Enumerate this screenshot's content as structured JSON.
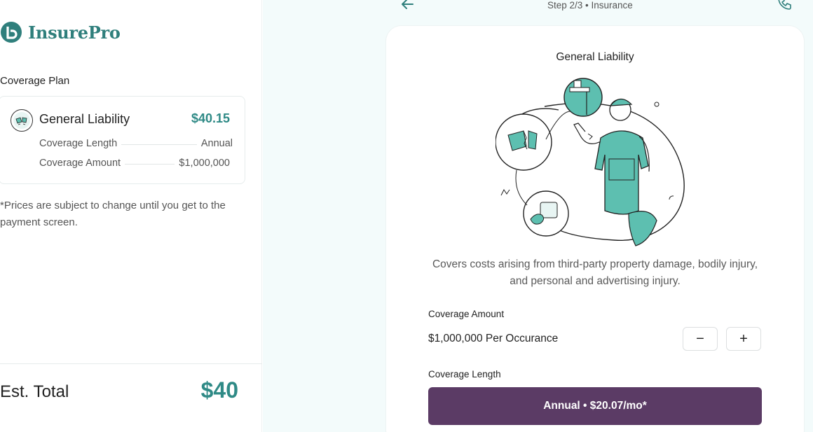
{
  "brand": {
    "name": "InsurePro",
    "color": "#2f7f7c"
  },
  "sidebar": {
    "plan_heading": "Coverage Plan",
    "plan": {
      "name": "General Liability",
      "price": "$40.15",
      "icon": "broken-vase-icon",
      "rows": [
        {
          "label": "Coverage Length",
          "value": "Annual"
        },
        {
          "label": "Coverage Amount",
          "value": "$1,000,000"
        }
      ]
    },
    "disclaimer": "*Prices are subject to change until you get to the payment screen.",
    "total": {
      "label": "Est. Total",
      "value": "$40"
    }
  },
  "header": {
    "step": "Step 2/3 • Insurance",
    "back_icon": "arrow-left-icon",
    "phone_icon": "phone-icon"
  },
  "card": {
    "title": "General Liability",
    "description": "Covers costs arising from third-party property damage, bodily injury, and personal and advertising injury.",
    "coverage_amount": {
      "label": "Coverage Amount",
      "value": "$1,000,000 Per Occurance",
      "minus": "−",
      "plus": "+"
    },
    "coverage_length": {
      "label": "Coverage Length",
      "selected": "Annual • $20.07/mo*"
    }
  },
  "colors": {
    "accent": "#2f8a86",
    "teal_fill": "#5dbfb0",
    "button": "#5b3b65",
    "background": "#f3fbfb"
  }
}
